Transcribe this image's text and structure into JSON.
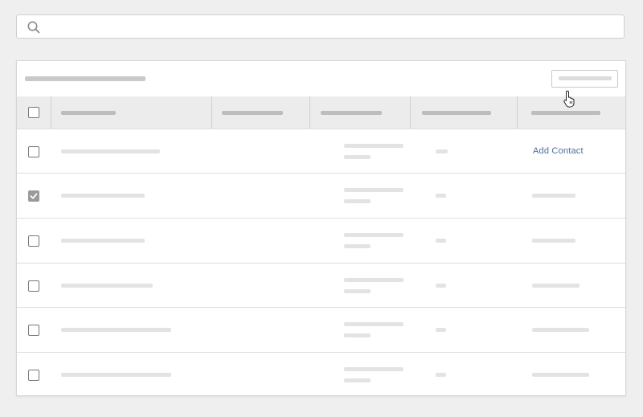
{
  "search": {
    "icon": "search-icon",
    "placeholder": ""
  },
  "table": {
    "select_all_checked": false,
    "rows": [
      {
        "checked": false,
        "action_label": "Add Contact"
      },
      {
        "checked": true,
        "action_label": ""
      },
      {
        "checked": false,
        "action_label": ""
      },
      {
        "checked": false,
        "action_label": ""
      },
      {
        "checked": false,
        "action_label": ""
      },
      {
        "checked": false,
        "action_label": ""
      }
    ]
  },
  "colors": {
    "link": "#4a6f9e",
    "checkbox_checked": "#9a9a9a",
    "placeholder_bar": "#e3e3e3"
  }
}
